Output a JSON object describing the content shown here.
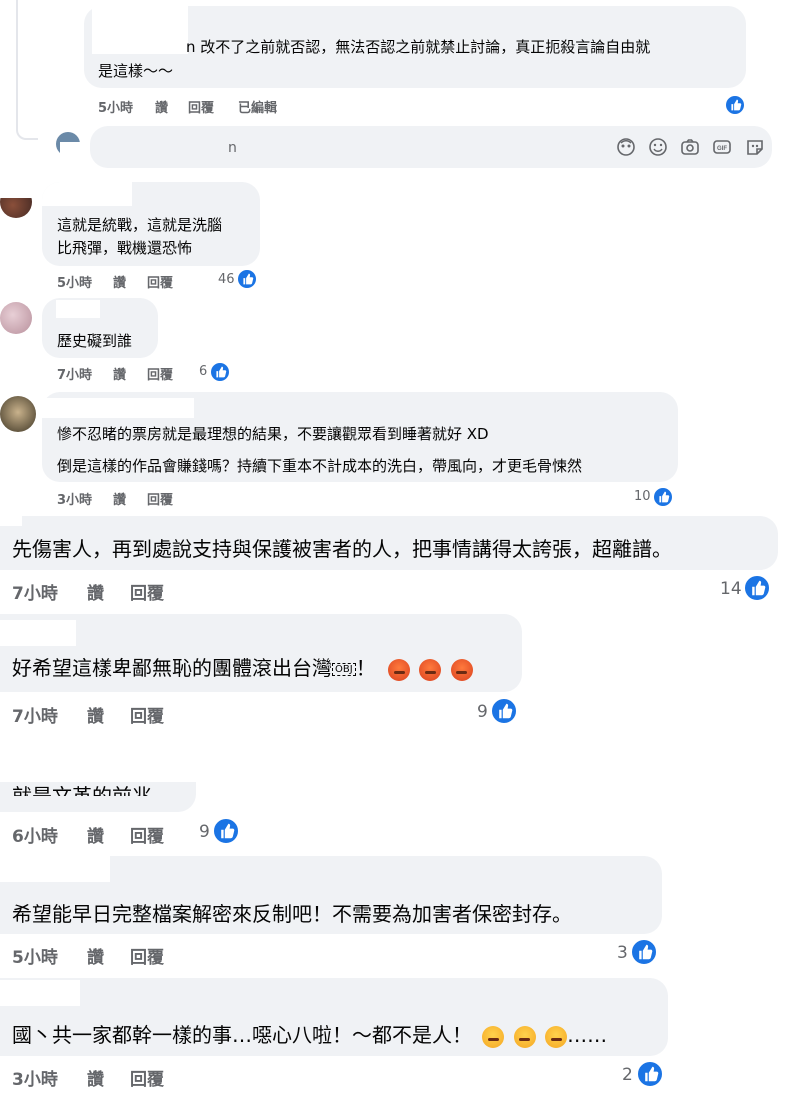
{
  "comments": [
    {
      "author": "",
      "text_lines": [
        "n 改不了之前就否認，無法否認之前就禁止討論，真正扼殺言論自由就",
        "是這樣～～"
      ],
      "time": "5小時",
      "like_label": "讚",
      "reply_label": "回覆",
      "edited_label": "已編輯",
      "like_count": ""
    },
    {
      "author": "",
      "text_lines": [
        "這就是統戰，這就是洗腦",
        "比飛彈，戰機還恐怖"
      ],
      "time": "5小時",
      "like_label": "讚",
      "reply_label": "回覆",
      "like_count": "46"
    },
    {
      "author": "",
      "text_lines": [
        "歷史礙到誰"
      ],
      "time": "7小時",
      "like_label": "讚",
      "reply_label": "回覆",
      "like_count": "6"
    },
    {
      "author": "",
      "text_lines": [
        "慘不忍睹的票房就是最理想的結果，不要讓觀眾看到睡著就好 XD",
        "倒是這樣的作品會賺錢嗎？持續下重本不計成本的洗白，帶風向，才更毛骨悚然"
      ],
      "time": "3小時",
      "like_label": "讚",
      "reply_label": "回覆",
      "like_count": "10"
    },
    {
      "author": "",
      "text_lines": [
        "先傷害人，再到處說支持與保護被害者的人，把事情講得太誇張，超離譜。"
      ],
      "time": "7小時",
      "like_label": "讚",
      "reply_label": "回覆",
      "like_count": "14"
    },
    {
      "author": "",
      "text_lines": [
        "好希望這樣卑鄙無恥的團體滾出台灣"
      ],
      "text_suffix": "！",
      "emojis": [
        "angry-face-emoji",
        "angry-face-emoji",
        "angry-face-emoji"
      ],
      "time": "7小時",
      "like_label": "讚",
      "reply_label": "回覆",
      "like_count": "9"
    },
    {
      "author": "",
      "text_lines": [
        "就是文革的前兆"
      ],
      "time": "6小時",
      "like_label": "讚",
      "reply_label": "回覆",
      "like_count": "9"
    },
    {
      "author": "",
      "text_lines": [
        "希望能早日完整檔案解密來反制吧！不需要為加害者保密封存。"
      ],
      "time": "5小時",
      "like_label": "讚",
      "reply_label": "回覆",
      "like_count": "3"
    },
    {
      "author": "",
      "text_lines": [
        "國丶共一家都幹一樣的事…噁心八啦！～都不是人！"
      ],
      "text_suffix": "……",
      "emojis": [
        "huffing-face-emoji",
        "huffing-face-emoji",
        "huffing-face-emoji"
      ],
      "time": "3小時",
      "like_label": "讚",
      "reply_label": "回覆",
      "like_count": "2"
    }
  ],
  "composer": {
    "placeholder": "n",
    "icons": [
      "avatar-sticker-icon",
      "emoji-icon",
      "camera-icon",
      "gif-icon",
      "sticker-icon"
    ]
  },
  "colors": {
    "bubble": "#f0f2f5",
    "meta": "#65676b",
    "like_blue": "#1b74e4"
  }
}
